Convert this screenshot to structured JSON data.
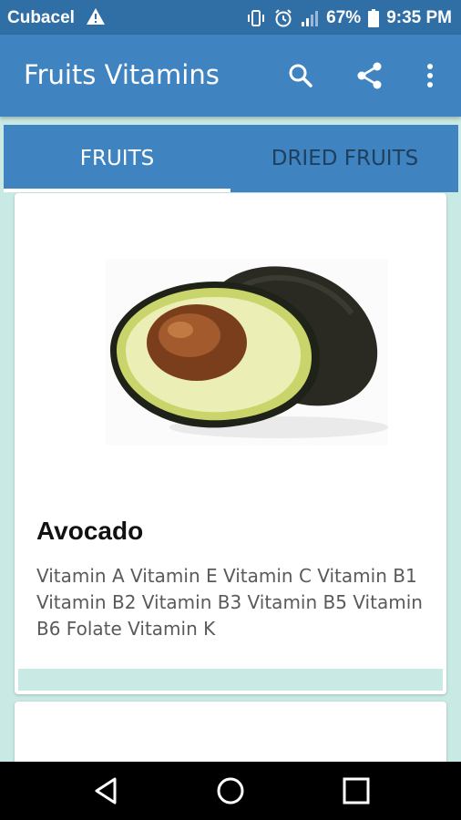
{
  "status_bar": {
    "carrier": "Cubacel",
    "battery": "67%",
    "time": "9:35 PM",
    "icons": [
      "warning-icon",
      "vibrate-icon",
      "alarm-icon",
      "signal-icon",
      "battery-icon"
    ]
  },
  "app_bar": {
    "title": "Fruits Vitamins",
    "actions": [
      "search-icon",
      "share-icon",
      "more-vert-icon"
    ]
  },
  "tabs": [
    {
      "label": "FRUITS",
      "selected": true
    },
    {
      "label": "DRIED FRUITS",
      "selected": false
    }
  ],
  "cards": [
    {
      "image": "avocado-image",
      "name": "Avocado",
      "vitamins": "Vitamin A Vitamin E Vitamin C Vitamin B1 Vitamin B2 Vitamin B3 Vitamin B5 Vitamin B6 Folate Vitamin K"
    }
  ],
  "nav_bar": {
    "buttons": [
      "back-icon",
      "home-icon",
      "recents-icon"
    ]
  },
  "colors": {
    "status_bar": "#2f6fa6",
    "app_bar": "#3f84c1",
    "background": "#c9e9e4",
    "tab_inactive_text": "#1f3f5e"
  }
}
